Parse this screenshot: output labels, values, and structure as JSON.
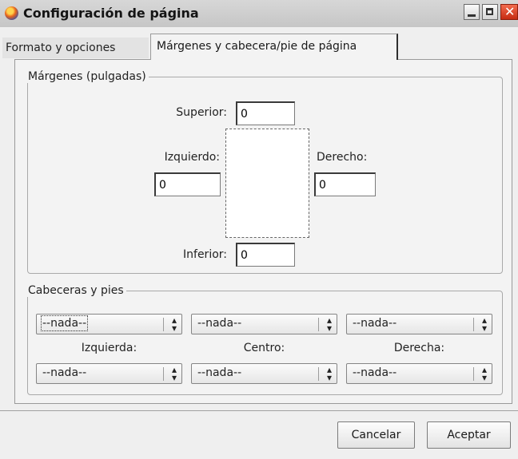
{
  "window": {
    "title": "Configuración de página",
    "controls": {
      "minimize": "minimize-icon",
      "maximize": "maximize-icon",
      "close": "close-icon"
    }
  },
  "tabs": [
    {
      "label": "Formato y opciones",
      "selected": false
    },
    {
      "label": "Márgenes y cabecera/pie de página",
      "selected": true
    }
  ],
  "margins": {
    "legend": "Márgenes (pulgadas)",
    "top": {
      "label": "Superior:",
      "value": "0"
    },
    "left": {
      "label": "Izquierdo:",
      "value": "0"
    },
    "right": {
      "label": "Derecho:",
      "value": "0"
    },
    "bottom": {
      "label": "Inferior:",
      "value": "0"
    }
  },
  "headers_footers": {
    "legend": "Cabeceras y pies",
    "headers": {
      "left": "--nada--",
      "center": "--nada--",
      "right": "--nada--"
    },
    "footers": {
      "left": "--nada--",
      "center": "--nada--",
      "right": "--nada--"
    },
    "column_labels": {
      "left": "Izquierda:",
      "center": "Centro:",
      "right": "Derecha:"
    }
  },
  "buttons": {
    "cancel": "Cancelar",
    "accept": "Aceptar"
  }
}
